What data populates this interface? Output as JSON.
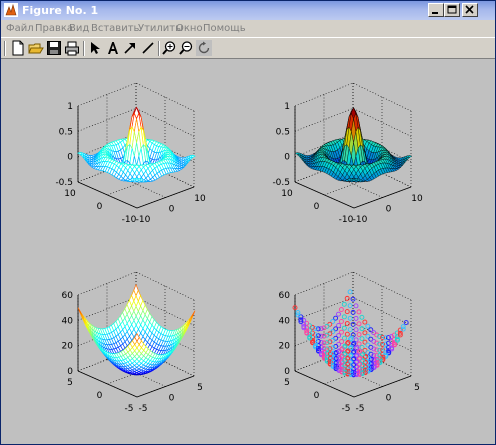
{
  "window": {
    "title": "Figure No. 1",
    "title_color": "#ffffff"
  },
  "window_buttons": [
    "minimize",
    "maximize",
    "close"
  ],
  "menu": [
    {
      "label": "Файл"
    },
    {
      "label": "Правка"
    },
    {
      "label": "Вид"
    },
    {
      "label": "Вставить"
    },
    {
      "label": "Утилиты"
    },
    {
      "label": "Окно"
    },
    {
      "label": "Помощь"
    }
  ],
  "toolbar": [
    {
      "icon": "new-file-icon"
    },
    {
      "icon": "open-folder-icon"
    },
    {
      "icon": "save-icon"
    },
    {
      "icon": "print-icon"
    },
    {
      "icon": "pointer-icon"
    },
    {
      "icon": "text-icon"
    },
    {
      "icon": "arrow-icon"
    },
    {
      "icon": "line-icon"
    },
    {
      "icon": "zoom-in-icon"
    },
    {
      "icon": "zoom-out-icon"
    },
    {
      "icon": "rotate-3d-icon"
    }
  ],
  "chart_data": [
    {
      "type": "surface",
      "style": "mesh",
      "zticks": [
        "1",
        "0.5",
        "0",
        "-0.5"
      ],
      "xticks": [
        "-10",
        "0",
        "10"
      ],
      "yticks": [
        "10",
        "0",
        "-10"
      ],
      "zlim": [
        -0.5,
        1
      ],
      "xlim": [
        -10,
        10
      ],
      "ylim": [
        -10,
        10
      ],
      "grid": true,
      "colormap": "jet"
    },
    {
      "type": "surface",
      "style": "surf",
      "zticks": [
        "1",
        "0.5",
        "0",
        "-0.5"
      ],
      "xticks": [
        "-10",
        "0",
        "10"
      ],
      "yticks": [
        "10",
        "0",
        "-10"
      ],
      "zlim": [
        -0.5,
        1
      ],
      "xlim": [
        -10,
        10
      ],
      "ylim": [
        -10,
        10
      ],
      "grid": true,
      "colormap": "jet"
    },
    {
      "type": "surface",
      "style": "mesh",
      "zticks": [
        "60",
        "40",
        "20",
        "0"
      ],
      "xticks": [
        "-5",
        "0",
        "5"
      ],
      "yticks": [
        "5",
        "0",
        "-5"
      ],
      "zlim": [
        0,
        60
      ],
      "xlim": [
        -5,
        5
      ],
      "ylim": [
        -5,
        5
      ],
      "grid": true,
      "colormap": "jet"
    },
    {
      "type": "surface",
      "style": "markers",
      "zticks": [
        "60",
        "40",
        "20",
        "0"
      ],
      "xticks": [
        "-5",
        "0",
        "5"
      ],
      "yticks": [
        "5",
        "0",
        "-5"
      ],
      "zlim": [
        0,
        60
      ],
      "xlim": [
        -5,
        5
      ],
      "ylim": [
        -5,
        5
      ],
      "grid": true,
      "colormap": "jet"
    }
  ]
}
